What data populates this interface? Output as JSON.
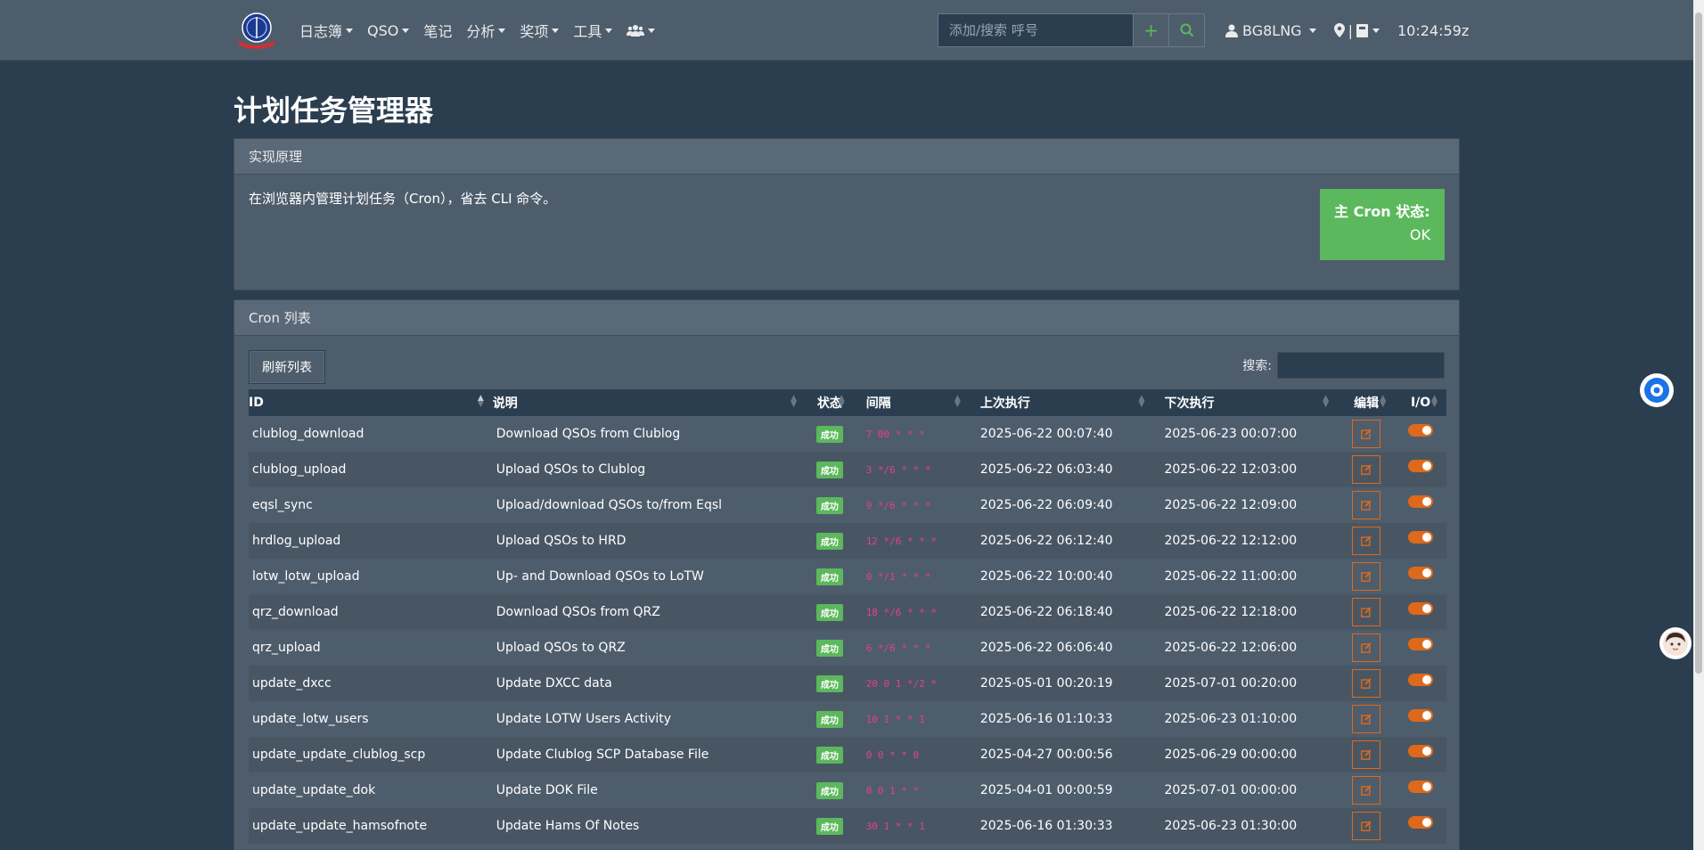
{
  "nav": {
    "items": [
      {
        "label": "日志簿",
        "dropdown": true
      },
      {
        "label": "QSO",
        "dropdown": true
      },
      {
        "label": "笔记",
        "dropdown": false
      },
      {
        "label": "分析",
        "dropdown": true
      },
      {
        "label": "奖项",
        "dropdown": true
      },
      {
        "label": "工具",
        "dropdown": true
      }
    ],
    "search_placeholder": "添加/搜索 呼号",
    "user": "BG8LNG",
    "time": "10:24:59z"
  },
  "page_title": "计划任务管理器",
  "principle": {
    "header": "实现原理",
    "text": "在浏览器内管理计划任务（Cron），省去 CLI 命令。",
    "cron_status_label": "主 Cron 状态:",
    "cron_status_value": "OK"
  },
  "cron_list": {
    "header": "Cron 列表",
    "refresh_label": "刷新列表",
    "search_label": "搜索:",
    "columns": [
      "ID",
      "说明",
      "状态",
      "间隔",
      "上次执行",
      "下次执行",
      "编辑",
      "I/O"
    ],
    "rows": [
      {
        "id": "clublog_download",
        "desc": "Download QSOs from Clublog",
        "status": "成功",
        "interval": "7 00 * * *",
        "last": "2025-06-22 00:07:40",
        "next": "2025-06-23 00:07:00"
      },
      {
        "id": "clublog_upload",
        "desc": "Upload QSOs to Clublog",
        "status": "成功",
        "interval": "3 */6 * * *",
        "last": "2025-06-22 06:03:40",
        "next": "2025-06-22 12:03:00"
      },
      {
        "id": "eqsl_sync",
        "desc": "Upload/download QSOs to/from Eqsl",
        "status": "成功",
        "interval": "9 */6 * * *",
        "last": "2025-06-22 06:09:40",
        "next": "2025-06-22 12:09:00"
      },
      {
        "id": "hrdlog_upload",
        "desc": "Upload QSOs to HRD",
        "status": "成功",
        "interval": "12 */6 * * *",
        "last": "2025-06-22 06:12:40",
        "next": "2025-06-22 12:12:00"
      },
      {
        "id": "lotw_lotw_upload",
        "desc": "Up- and Download QSOs to LoTW",
        "status": "成功",
        "interval": "0 */1 * * *",
        "last": "2025-06-22 10:00:40",
        "next": "2025-06-22 11:00:00"
      },
      {
        "id": "qrz_download",
        "desc": "Download QSOs from QRZ",
        "status": "成功",
        "interval": "18 */6 * * *",
        "last": "2025-06-22 06:18:40",
        "next": "2025-06-22 12:18:00"
      },
      {
        "id": "qrz_upload",
        "desc": "Upload QSOs to QRZ",
        "status": "成功",
        "interval": "6 */6 * * *",
        "last": "2025-06-22 06:06:40",
        "next": "2025-06-22 12:06:00"
      },
      {
        "id": "update_dxcc",
        "desc": "Update DXCC data",
        "status": "成功",
        "interval": "20 0 1 */2 *",
        "last": "2025-05-01 00:20:19",
        "next": "2025-07-01 00:20:00"
      },
      {
        "id": "update_lotw_users",
        "desc": "Update LOTW Users Activity",
        "status": "成功",
        "interval": "10 1 * * 1",
        "last": "2025-06-16 01:10:33",
        "next": "2025-06-23 01:10:00"
      },
      {
        "id": "update_update_clublog_scp",
        "desc": "Update Clublog SCP Database File",
        "status": "成功",
        "interval": "0 0 * * 0",
        "last": "2025-04-27 00:00:56",
        "next": "2025-06-29 00:00:00"
      },
      {
        "id": "update_update_dok",
        "desc": "Update DOK File",
        "status": "成功",
        "interval": "0 0 1 * *",
        "last": "2025-04-01 00:00:59",
        "next": "2025-07-01 00:00:00"
      },
      {
        "id": "update_update_hamsofnote",
        "desc": "Update Hams Of Notes",
        "status": "成功",
        "interval": "30 1 * * 1",
        "last": "2025-06-16 01:30:33",
        "next": "2025-06-23 01:30:00"
      }
    ]
  },
  "colors": {
    "accent": "#df691a",
    "success": "#5cb85c",
    "bg": "#2b3e50",
    "panel": "#4e5d6c",
    "code": "#e83e8c"
  }
}
